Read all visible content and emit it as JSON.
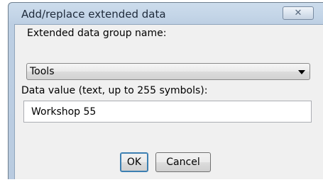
{
  "window": {
    "title": "Add/replace extended data",
    "close_symbol": "✕"
  },
  "form": {
    "group_label": "Extended data group name:",
    "group_selected": "Tools",
    "value_label": "Data value (text, up to 255 symbols):",
    "value_text": "Workshop 55"
  },
  "buttons": {
    "ok": "OK",
    "cancel": "Cancel"
  }
}
